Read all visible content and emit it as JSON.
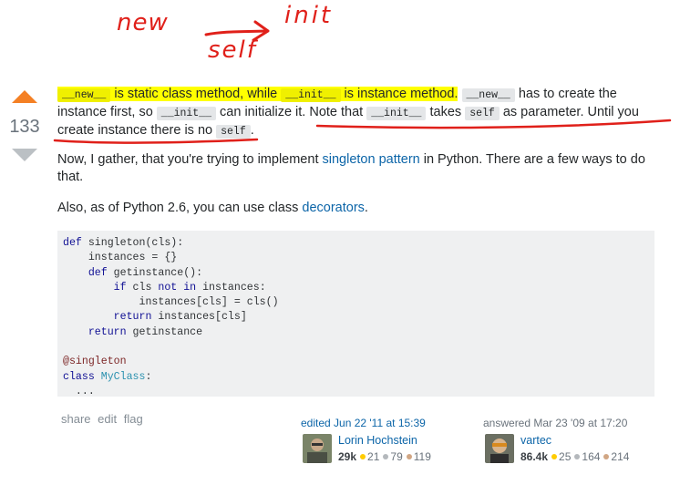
{
  "annotations": {
    "word_new": "new",
    "word_init": "init",
    "word_self": "self",
    "color": "#e0201a"
  },
  "votes": {
    "score": "133",
    "up_color": "#f48024",
    "down_color": "#bbc0c4"
  },
  "para1": {
    "code_new": "__new__",
    "t1": " is static class method, while ",
    "code_init": "__init__",
    "t2": " is instance method.",
    "code_new2": "__new__",
    "t3": " has to create the instance first, so ",
    "code_init2": "__init__",
    "t4": " can initialize it. Note that ",
    "code_init3": "__init__",
    "t5": " takes ",
    "code_self": "self",
    "t6": " as parameter. Until you create instance there is no ",
    "code_self2": "self",
    "t7": "."
  },
  "para2": {
    "t1": "Now, I gather, that you're trying to implement ",
    "link": "singleton pattern",
    "t2": " in Python. There are a few ways to do that."
  },
  "para3": {
    "t1": "Also, as of Python 2.6, you can use class ",
    "link": "decorators",
    "t2": "."
  },
  "code_lines": {
    "l1_kw": "def",
    "l1_rest": " singleton(cls):",
    "l2": "    instances = {}",
    "l3_ind": "    ",
    "l3_kw": "def",
    "l3_rest": " getinstance():",
    "l4_ind": "        ",
    "l4_kw": "if",
    "l4_mid": " cls ",
    "l4_kw2": "not in",
    "l4_rest": " instances:",
    "l5": "            instances[cls] = cls()",
    "l6_ind": "        ",
    "l6_kw": "return",
    "l6_rest": " instances[cls]",
    "l7_ind": "    ",
    "l7_kw": "return",
    "l7_rest": " getinstance",
    "l9": "@singleton",
    "l10_kw": "class",
    "l10_name": " MyClass",
    "l10_rest": ":",
    "l11": "  ..."
  },
  "post_menu": {
    "share": "share",
    "edit": "edit",
    "flag": "flag"
  },
  "editor": {
    "label": "edited Jun 22 '11 at 15:39",
    "name": "Lorin Hochstein",
    "rep": "29k",
    "gold": "21",
    "silver": "79",
    "bronze": "119"
  },
  "author": {
    "label": "answered Mar 23 '09 at 17:20",
    "name": "vartec",
    "rep": "86.4k",
    "gold": "25",
    "silver": "164",
    "bronze": "214"
  },
  "badge_colors": {
    "gold": "#ffcc01",
    "silver": "#b4b8bc",
    "bronze": "#d1a684"
  }
}
